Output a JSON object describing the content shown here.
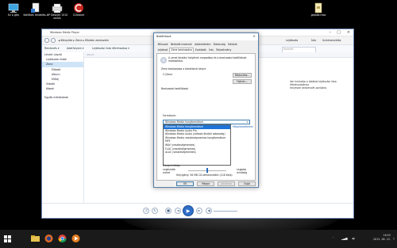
{
  "desktop": {
    "icons": [
      {
        "label": "Ez a gép"
      },
      {
        "label": "Kellékek rendelés..."
      },
      {
        "label": "HP Deskjet 1510 series"
      },
      {
        "label": "CCleaner"
      },
      {
        "label": "gepdia.mov"
      }
    ]
  },
  "wmp": {
    "title": "Windows Media Player",
    "breadcrumb": "◄ Könyvtár ▸ Zene ▸ Minden zeneszám",
    "tabs": [
      "Lejátszás",
      "Írás",
      "Szinkronizálás"
    ],
    "toolbar": [
      "Rendezés ▾",
      "Adatfolyam ▾",
      "Lejátszási lista létrehozása ▾"
    ],
    "search_placeholder": "Keresés",
    "sidebar": [
      "Lénárt László",
      "Lejátszási listák",
      "Zene",
      "Előadó",
      "Album",
      "Műfaj",
      "Videók",
      "Képek",
      "Egyéb médiatárak"
    ],
    "columns": [
      "Album"
    ],
    "hint": "Ide húzhatja a listákat lejátszási lista létrehozásához",
    "hint2": "helyezze kedvencét pontjára."
  },
  "dialog": {
    "title": "Beállítások",
    "tabs_row1": [
      "Műsorok",
      "Beépülő modulok",
      "Adatvédelem",
      "Biztonság",
      "Hálózat"
    ],
    "tabs_row2": [
      "Lejátszó",
      "Zene beolvasása",
      "Eszközök",
      "Írás",
      "Teljesítmény"
    ],
    "active_tab": "Zene beolvasása",
    "desc": "A zenei tárolási helyének megadása és a beolvasási beállítások módosítása.",
    "location_group": "Zene beolvasása a következő helyre",
    "location_path": "C:\\Zene",
    "change_button": "Módosítás...",
    "filename_button": "Fájlnév...",
    "settings_group": "Beolvasási beállítások",
    "format_label": "Formátum:",
    "format_selected": "Windows Media hangformátum",
    "format_options": [
      "Windows Media hangformátum",
      "Windows Media Audio Pro",
      "Windows Media Audio (változó átviteli sebesség)",
      "Windows Media veszteségmentes hangformátum",
      "MP3",
      "WAV (veszteségmentes)",
      "FLAC (veszteségmentes)",
      "ALAC (veszteségmentes)"
    ],
    "copy_link": "Másolásvédelem",
    "quality_label": "Hangminőség:",
    "quality_min": "Legkisebb méret",
    "quality_max": "Legjobb minőség",
    "quality_info": "Helyigény: 56 MB CD-lemezenként (128 Kb/s).",
    "quality_fraction": 0.5,
    "ok": "OK",
    "cancel": "Mégse",
    "apply": "Alkalmaz",
    "help": "Súgó"
  },
  "taskbar": {
    "time": "16:55",
    "date": "2015. 08. 22.",
    "tray_lang": "HUN"
  }
}
